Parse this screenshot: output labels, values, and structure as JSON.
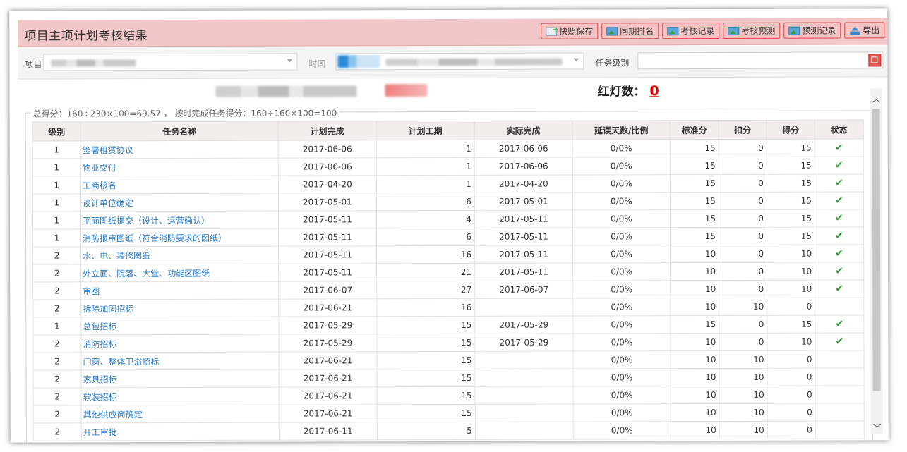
{
  "header": {
    "title": "项目主项计划考核结果",
    "buttons": [
      {
        "label": "快照保存",
        "icon": "save-plus-icon"
      },
      {
        "label": "同期排名",
        "icon": "image-icon"
      },
      {
        "label": "考核记录",
        "icon": "image-icon"
      },
      {
        "label": "考核预测",
        "icon": "image-icon"
      },
      {
        "label": "预测记录",
        "icon": "image-icon"
      },
      {
        "label": "导出",
        "icon": "upload-icon"
      }
    ]
  },
  "filters": {
    "project_label": "项目",
    "time_label": "时间",
    "task_level_label": "任务级别"
  },
  "summary": {
    "red_light_label": "红灯数：",
    "red_light_count": "0",
    "score_formula": "总得分：160÷230×100=69.57 ， 按时完成任务得分：160÷160×100=100"
  },
  "table": {
    "columns": [
      "级别",
      "任务名称",
      "计划完成",
      "计划工期",
      "实际完成",
      "延误天数/比例",
      "标准分",
      "扣分",
      "得分",
      "状态"
    ],
    "rows": [
      {
        "level": "1",
        "name": "签署租赁协议",
        "plan": "2017-06-06",
        "duration": "1",
        "actual": "2017-06-06",
        "delay": "0/0%",
        "std": "15",
        "deduct": "0",
        "score": "15",
        "status": "✔"
      },
      {
        "level": "1",
        "name": "物业交付",
        "plan": "2017-06-06",
        "duration": "1",
        "actual": "2017-06-06",
        "delay": "0/0%",
        "std": "15",
        "deduct": "0",
        "score": "15",
        "status": "✔"
      },
      {
        "level": "1",
        "name": "工商核名",
        "plan": "2017-04-20",
        "duration": "1",
        "actual": "2017-04-20",
        "delay": "0/0%",
        "std": "15",
        "deduct": "0",
        "score": "15",
        "status": "✔"
      },
      {
        "level": "1",
        "name": "设计单位确定",
        "plan": "2017-05-01",
        "duration": "6",
        "actual": "2017-05-01",
        "delay": "0/0%",
        "std": "15",
        "deduct": "0",
        "score": "15",
        "status": "✔"
      },
      {
        "level": "1",
        "name": "平面图纸提交（设计、运营确认）",
        "plan": "2017-05-11",
        "duration": "4",
        "actual": "2017-05-11",
        "delay": "0/0%",
        "std": "15",
        "deduct": "0",
        "score": "15",
        "status": "✔"
      },
      {
        "level": "1",
        "name": "消防报审图纸（符合消防要求的图纸）",
        "plan": "2017-05-11",
        "duration": "6",
        "actual": "2017-05-11",
        "delay": "0/0%",
        "std": "15",
        "deduct": "0",
        "score": "15",
        "status": "✔"
      },
      {
        "level": "2",
        "name": "水、电、装修图纸",
        "plan": "2017-05-11",
        "duration": "16",
        "actual": "2017-05-11",
        "delay": "0/0%",
        "std": "10",
        "deduct": "0",
        "score": "10",
        "status": "✔"
      },
      {
        "level": "2",
        "name": "外立面、院落、大堂、功能区图纸",
        "plan": "2017-05-11",
        "duration": "21",
        "actual": "2017-05-11",
        "delay": "0/0%",
        "std": "10",
        "deduct": "0",
        "score": "10",
        "status": "✔"
      },
      {
        "level": "2",
        "name": "审图",
        "plan": "2017-06-07",
        "duration": "27",
        "actual": "2017-06-07",
        "delay": "0/0%",
        "std": "10",
        "deduct": "0",
        "score": "10",
        "status": "✔"
      },
      {
        "level": "2",
        "name": "拆除加固招标",
        "plan": "2017-06-21",
        "duration": "16",
        "actual": "",
        "delay": "0/0%",
        "std": "10",
        "deduct": "10",
        "score": "0",
        "status": ""
      },
      {
        "level": "1",
        "name": "总包招标",
        "plan": "2017-05-29",
        "duration": "15",
        "actual": "2017-05-29",
        "delay": "0/0%",
        "std": "15",
        "deduct": "0",
        "score": "15",
        "status": "✔"
      },
      {
        "level": "2",
        "name": "消防招标",
        "plan": "2017-05-29",
        "duration": "15",
        "actual": "2017-05-29",
        "delay": "0/0%",
        "std": "10",
        "deduct": "0",
        "score": "10",
        "status": "✔"
      },
      {
        "level": "2",
        "name": "门窗、整体卫浴招标",
        "plan": "2017-06-21",
        "duration": "15",
        "actual": "",
        "delay": "0/0%",
        "std": "10",
        "deduct": "10",
        "score": "0",
        "status": ""
      },
      {
        "level": "2",
        "name": "家具招标",
        "plan": "2017-06-21",
        "duration": "15",
        "actual": "",
        "delay": "0/0%",
        "std": "10",
        "deduct": "10",
        "score": "0",
        "status": ""
      },
      {
        "level": "2",
        "name": "软装招标",
        "plan": "2017-06-21",
        "duration": "15",
        "actual": "",
        "delay": "0/0%",
        "std": "10",
        "deduct": "10",
        "score": "0",
        "status": ""
      },
      {
        "level": "2",
        "name": "其他供应商确定",
        "plan": "2017-06-21",
        "duration": "15",
        "actual": "",
        "delay": "0/0%",
        "std": "10",
        "deduct": "10",
        "score": "0",
        "status": ""
      },
      {
        "level": "2",
        "name": "开工审批",
        "plan": "2017-06-11",
        "duration": "5",
        "actual": "",
        "delay": "0/0%",
        "std": "10",
        "deduct": "10",
        "score": "0",
        "status": ""
      }
    ]
  },
  "colors": {
    "header_bg": "#f1c7c9",
    "button_border": "#d94545",
    "link": "#2a7ac8",
    "check": "#2e9e2e",
    "red_count": "#e00000"
  }
}
